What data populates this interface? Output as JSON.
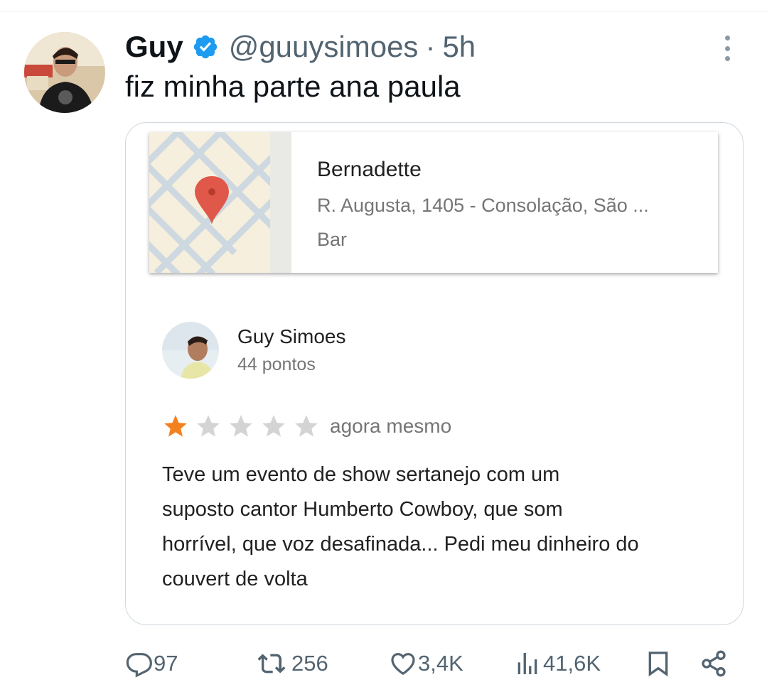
{
  "tweet": {
    "display_name": "Guy",
    "handle": "@guuysimoes",
    "separator": "·",
    "time": "5h",
    "text": "fiz minha parte ana paula",
    "verified_icon": "verified-badge-icon",
    "more_icon": "more-options-icon"
  },
  "place_card": {
    "name": "Bernadette",
    "address": "R. Augusta, 1405 - Consolação, São ...",
    "category": "Bar",
    "map_icon": "map-pin-icon"
  },
  "review": {
    "reviewer_name": "Guy Simoes",
    "reviewer_points": "44 pontos",
    "rating": 1,
    "max_rating": 5,
    "time": "agora mesmo",
    "lines": [
      "Teve um evento de show sertanejo com um",
      "suposto cantor Humberto Cowboy, que som",
      "horrível, que voz desafinada... Pedi meu dinheiro do",
      "couvert de volta"
    ]
  },
  "actions": {
    "replies": "97",
    "reposts": "256",
    "likes": "3,4K",
    "views": "41,6K",
    "reply_icon": "reply-icon",
    "repost_icon": "repost-icon",
    "like_icon": "heart-icon",
    "views_icon": "views-icon",
    "bookmark_icon": "bookmark-icon",
    "share_icon": "share-icon"
  },
  "colors": {
    "verified_blue": "#1d9bf0",
    "star_filled": "#f4811f",
    "star_empty": "#d4d4d4",
    "muted_text": "#536471",
    "pin_red": "#e0584a"
  }
}
